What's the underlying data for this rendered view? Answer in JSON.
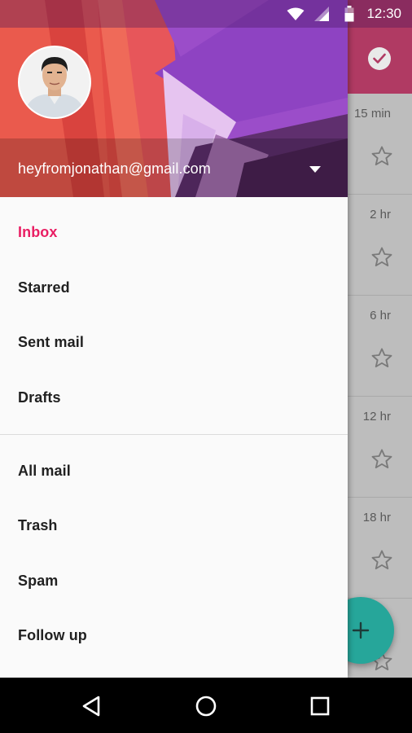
{
  "status_bar": {
    "time": "12:30"
  },
  "account": {
    "email": "heyfromjonathan@gmail.com"
  },
  "drawer": {
    "primary_items": [
      {
        "label": "Inbox",
        "active": true
      },
      {
        "label": "Starred"
      },
      {
        "label": "Sent mail"
      },
      {
        "label": "Drafts"
      }
    ],
    "secondary_items": [
      {
        "label": "All mail"
      },
      {
        "label": "Trash"
      },
      {
        "label": "Spam"
      },
      {
        "label": "Follow up"
      }
    ]
  },
  "mail_list": {
    "times": [
      "15 min",
      "2 hr",
      "6 hr",
      "12 hr",
      "18 hr"
    ]
  },
  "colors": {
    "accent": "#e91e63",
    "toolbar": "#b03a63",
    "fab": "#26a69a"
  },
  "icons": {
    "status": [
      "wifi-icon",
      "signal-icon",
      "battery-icon"
    ],
    "navigation": [
      "back-icon",
      "home-icon",
      "recents-icon"
    ],
    "toolbar": "check-circle-icon",
    "fab": "plus-icon",
    "row": "star-outline-icon"
  }
}
